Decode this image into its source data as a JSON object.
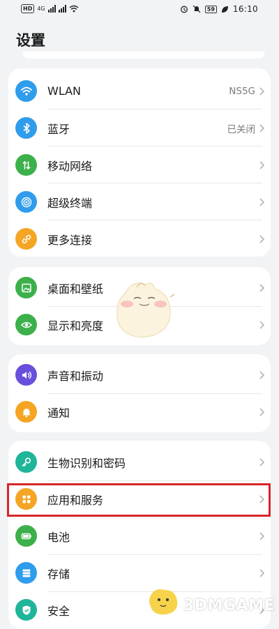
{
  "status_bar": {
    "hd_label": "HD",
    "network_label": "4G",
    "battery_label": "59",
    "time": "16:10"
  },
  "page": {
    "title": "设置"
  },
  "groups": [
    {
      "items": [
        {
          "label": "WLAN",
          "value": "NS5G",
          "icon": "wifi-icon",
          "color": "#2f9cec"
        },
        {
          "label": "蓝牙",
          "value": "已关闭",
          "icon": "bluetooth-icon",
          "color": "#2f9cec"
        },
        {
          "label": "移动网络",
          "value": "",
          "icon": "mobile-data-icon",
          "color": "#3cb04a"
        },
        {
          "label": "超级终端",
          "value": "",
          "icon": "super-device-icon",
          "color": "#2f9cec"
        },
        {
          "label": "更多连接",
          "value": "",
          "icon": "link-icon",
          "color": "#f5a524"
        }
      ]
    },
    {
      "items": [
        {
          "label": "桌面和壁纸",
          "value": "",
          "icon": "wallpaper-icon",
          "color": "#3cb04a"
        },
        {
          "label": "显示和亮度",
          "value": "",
          "icon": "eye-icon",
          "color": "#3cb04a"
        }
      ]
    },
    {
      "items": [
        {
          "label": "声音和振动",
          "value": "",
          "icon": "sound-icon",
          "color": "#6a4fdc"
        },
        {
          "label": "通知",
          "value": "",
          "icon": "bell-icon",
          "color": "#f5a524"
        }
      ]
    },
    {
      "items": [
        {
          "label": "生物识别和密码",
          "value": "",
          "icon": "key-icon",
          "color": "#1fb59b"
        },
        {
          "label": "应用和服务",
          "value": "",
          "icon": "apps-icon",
          "color": "#f5a524"
        },
        {
          "label": "电池",
          "value": "",
          "icon": "battery-icon",
          "color": "#3cb04a"
        },
        {
          "label": "存储",
          "value": "",
          "icon": "storage-icon",
          "color": "#2f9cec"
        },
        {
          "label": "安全",
          "value": "",
          "icon": "shield-icon",
          "color": "#1fb59b"
        }
      ]
    }
  ],
  "watermark": {
    "text": "3DMGAME"
  },
  "colors": {
    "highlight": "#d62529",
    "background": "#f1f3f5"
  }
}
